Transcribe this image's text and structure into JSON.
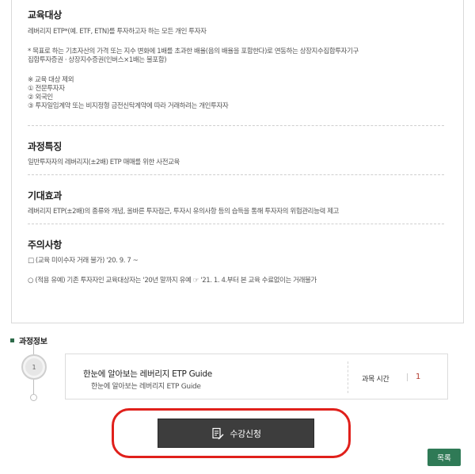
{
  "target": {
    "title": "교육대상",
    "desc": "레버리지 ETP*(예. ETF, ETN)를 투자하고자 하는 모든 개인 투자자",
    "note_line1": "* 목표로 하는 기초자산의 가격 또는 지수 변화에 1배를 초과한 배율(음의 배율을 포함한다)로 연동하는 상장지수집합투자기구",
    "note_line2": "집합투자증권 · 상장지수증권(인버스×1배는 불포함)",
    "exclusion_title": "※ 교육 대상 제외",
    "exclusions": [
      "① 전문투자자",
      "② 외국인",
      "③ 투자일임계약 또는 비지정형 금전신탁계약에 따라 거래하려는 개인투자자"
    ]
  },
  "features": {
    "title": "과정특징",
    "desc": "일반투자자의 레버리지(±2배) ETP 매매를 위한 사전교육"
  },
  "effects": {
    "title": "기대효과",
    "desc": "레버리지 ETP(±2배)의 종류와 개념, 올바른 투자접근, 투자시 유의사항 등의 습득을 통해 투자자의 위험관리능력 제고"
  },
  "notice": {
    "title": "주의사항",
    "line1": "□ (교육 미이수자 거래 불가) '20. 9. 7 ~",
    "line2": "○ (적용 유예) 기존 투자자인 교육대상자는 '20년 말까지 유예 ☞ '21. 1. 4.부터 본 교육 수료없이는 거래불가"
  },
  "course_info": {
    "header": "과정정보",
    "step_number": "1",
    "course_title": "한눈에 알아보는 레버리지 ETP Guide",
    "course_subtitle": "한눈에 알아보는 레버리지 ETP Guide",
    "duration_label": "과목 시간",
    "duration_value": "1"
  },
  "actions": {
    "enroll_label": "수강신청",
    "list_label": "목록"
  },
  "colors": {
    "highlight_ring": "#e0201b",
    "enroll_bg": "#3d3d3d",
    "list_bg": "#2f7a56",
    "duration_value": "#b23a2e"
  },
  "icons": {
    "enroll": "document-edit-icon",
    "header": "square-bullet-icon"
  }
}
